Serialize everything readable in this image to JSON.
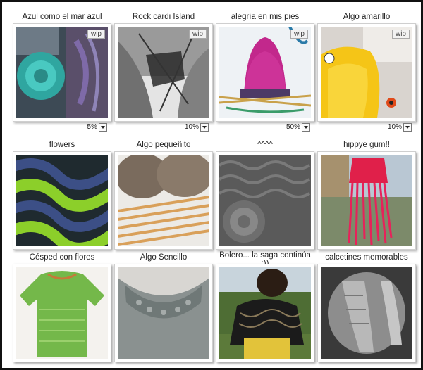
{
  "items": [
    {
      "title": "Azul como el mar azul",
      "wip": "wip",
      "progress": "5%"
    },
    {
      "title": "Rock cardi Island",
      "wip": "wip",
      "progress": "10%"
    },
    {
      "title": "alegría en mis pies",
      "wip": "wip",
      "progress": "50%"
    },
    {
      "title": "Algo amarillo",
      "wip": "wip",
      "progress": "10%"
    },
    {
      "title": "flowers"
    },
    {
      "title": "Algo pequeñito"
    },
    {
      "title": "^^^^"
    },
    {
      "title": "hippye gum!!"
    },
    {
      "title": "Césped con flores"
    },
    {
      "title": "Algo Sencillo"
    },
    {
      "title": "Bolero... la saga continúa :))"
    },
    {
      "title": "calcetines memorables"
    }
  ],
  "colors": {
    "frame": "#111111",
    "background": "#ffffff"
  }
}
